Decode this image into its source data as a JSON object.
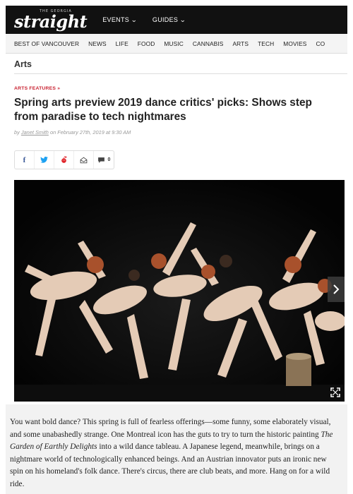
{
  "header": {
    "logo_small": "THE GEORGIA",
    "logo_main": "straight",
    "nav": [
      {
        "label": "EVENTS"
      },
      {
        "label": "GUIDES"
      }
    ]
  },
  "section_nav": [
    "BEST OF VANCOUVER",
    "NEWS",
    "LIFE",
    "FOOD",
    "MUSIC",
    "CANNABIS",
    "ARTS",
    "TECH",
    "MOVIES",
    "CO"
  ],
  "section_title": "Arts",
  "article": {
    "kicker": "ARTS FEATURES »",
    "headline": "Spring arts preview 2019 dance critics' picks: Shows step from paradise to tech nightmares",
    "byline_prefix": "by",
    "author": "Janet Smith",
    "date": "on February 27th, 2019 at 9:30 AM",
    "comment_count": "0",
    "body_parts": {
      "p1": "You want bold dance? This spring is full of fearless offerings—some funny, some elaborately visual, and some unabashedly strange. One Montreal icon has the guts to try to turn the historic painting ",
      "italic": "The Garden of Earthly Delights",
      "p2": " into a wild dance tableau. A Japanese legend, meanwhile, brings on a nightmare world of technologically enhanced beings. And an Austrian innovator puts an ironic new spin on his homeland's folk dance. There's circus, there are club beats, and more. Hang on for a wild ride."
    }
  },
  "icons": {
    "share": [
      "facebook-icon",
      "twitter-icon",
      "reddit-icon",
      "email-icon",
      "comment-icon"
    ],
    "gallery": [
      "chevron-right-icon",
      "expand-icon"
    ]
  },
  "colors": {
    "topbar": "#111111",
    "kicker": "#c8202f",
    "facebook": "#3b5998",
    "twitter": "#1da1f2",
    "reddit": "#e0242a"
  }
}
